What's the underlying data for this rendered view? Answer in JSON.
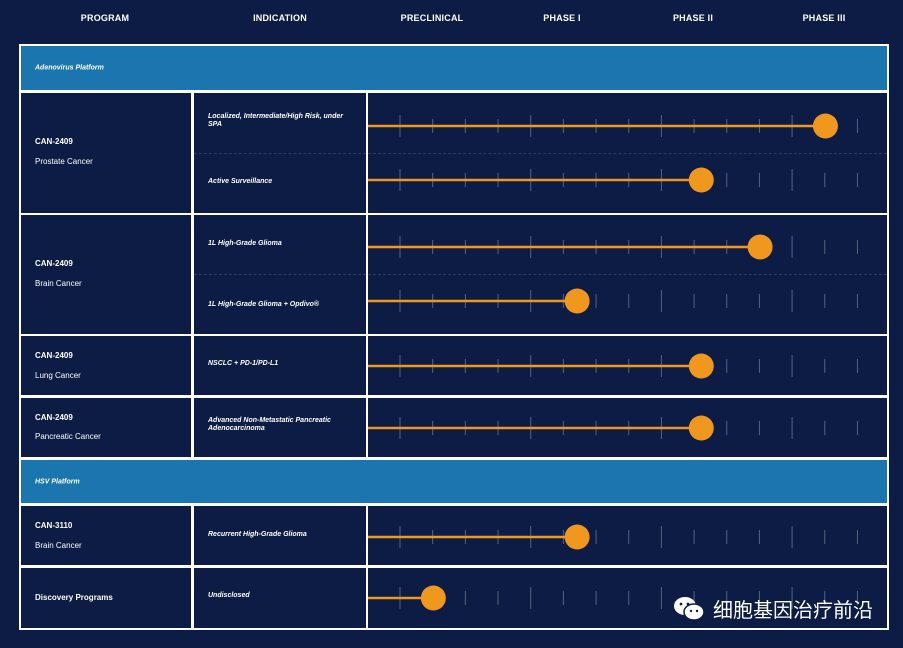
{
  "headers": [
    "PROGRAM",
    "INDICATION",
    "PRECLINICAL",
    "PHASE I",
    "PHASE II",
    "PHASE III"
  ],
  "platforms": [
    {
      "label": "Adenovirus Platform"
    },
    {
      "label": "HSV Platform"
    }
  ],
  "programs": [
    {
      "name": "CAN-2409",
      "sub": "Prostate Cancer",
      "rows": [
        {
          "indication": "Localized, Intermediate/High Risk, under SPA"
        },
        {
          "indication": "Active Surveillance"
        }
      ]
    },
    {
      "name": "CAN-2409",
      "sub": "Brain Cancer",
      "rows": [
        {
          "indication": "1L High-Grade Glioma"
        },
        {
          "indication": "1L High-Grade Glioma + Opdivo®"
        }
      ]
    },
    {
      "name": "CAN-2409",
      "sub": "Lung Cancer",
      "rows": [
        {
          "indication": "NSCLC + PD-1/PD-L1"
        }
      ]
    },
    {
      "name": "CAN-2409",
      "sub": "Pancreatic Cancer",
      "rows": [
        {
          "indication": "Advanced Non-Metastatic Pancreatic Adenocarcinoma"
        }
      ]
    },
    {
      "name": "CAN-3110",
      "sub": "Brain Cancer",
      "rows": [
        {
          "indication": "Recurrent High-Grade Glioma"
        }
      ]
    },
    {
      "name": "Discovery Programs",
      "sub": "",
      "rows": [
        {
          "indication": "Undisclosed"
        }
      ]
    }
  ],
  "watermark": {
    "text": "细胞基因治疗前沿",
    "icon": "wechat-icon"
  },
  "colors": {
    "background": "#0c1c44",
    "platform": "#1b75ae",
    "bar": "#f0981e"
  },
  "chart_data": {
    "type": "bar",
    "orientation": "horizontal",
    "stages": [
      "PRECLINICAL",
      "PHASE I",
      "PHASE II",
      "PHASE III"
    ],
    "scale_note": "progress measured in stage units: 1.0 = end of Preclinical, 4.0 = end of Phase III",
    "series": [
      {
        "program": "CAN-2409",
        "indication": "Localized, Intermediate/High Risk, under SPA",
        "progress": 3.5
      },
      {
        "program": "CAN-2409",
        "indication": "Active Surveillance",
        "progress": 2.55
      },
      {
        "program": "CAN-2409",
        "indication": "1L High-Grade Glioma",
        "progress": 3.0
      },
      {
        "program": "CAN-2409",
        "indication": "1L High-Grade Glioma + Opdivo®",
        "progress": 1.6
      },
      {
        "program": "CAN-2409",
        "indication": "NSCLC + PD-1/PD-L1",
        "progress": 2.55
      },
      {
        "program": "CAN-2409",
        "indication": "Advanced Non-Metastatic Pancreatic Adenocarcinoma",
        "progress": 2.55
      },
      {
        "program": "CAN-3110",
        "indication": "Recurrent High-Grade Glioma",
        "progress": 1.6
      },
      {
        "program": "Discovery Programs",
        "indication": "Undisclosed",
        "progress": 0.5
      }
    ]
  }
}
